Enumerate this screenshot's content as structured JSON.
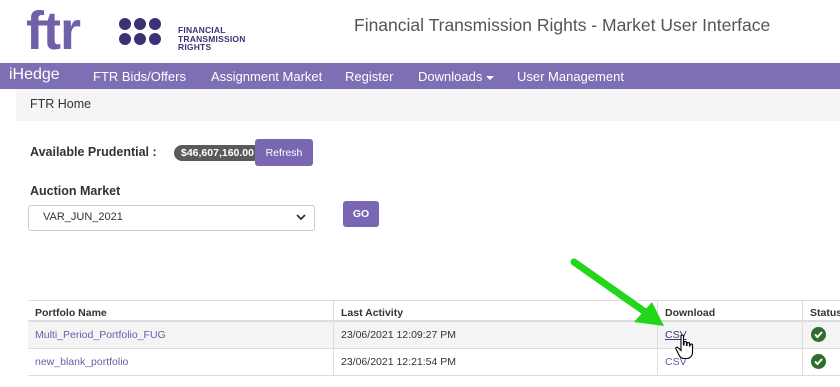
{
  "header": {
    "logo_letters": "ftr",
    "logo_lines": [
      "FINANCIAL",
      "TRANSMISSION",
      "RIGHTS"
    ],
    "app_title": "Financial Transmission Rights - Market User Interface"
  },
  "nav": {
    "brand": "iHedge",
    "items": [
      {
        "label": "FTR Bids/Offers"
      },
      {
        "label": "Assignment Market"
      },
      {
        "label": "Register"
      },
      {
        "label": "Downloads"
      },
      {
        "label": "User Management"
      }
    ]
  },
  "breadcrumb": "FTR Home",
  "prudential": {
    "label": "Available Prudential :",
    "amount": "$46,607,160.00",
    "refresh_label": "Refresh"
  },
  "auction": {
    "label": "Auction Market",
    "selected": "VAR_JUN_2021",
    "go_label": "GO"
  },
  "table": {
    "headers": [
      "Portfolo Name",
      "Last Activity",
      "Download",
      "Status"
    ],
    "rows": [
      {
        "name": "Multi_Period_Portfolio_FUG",
        "last_activity": "23/06/2021 12:09:27 PM",
        "download": "CSV",
        "status": "check-circle-icon"
      },
      {
        "name": "new_blank_portfolio",
        "last_activity": "23/06/2021 12:21:54 PM",
        "download": "CSV",
        "status": "check-circle-icon"
      }
    ]
  },
  "colors": {
    "brand_purple": "#7e6fb4",
    "button_purple": "#7a67b3",
    "arrow_green": "#22d61a",
    "status_green": "#2d6e2e"
  }
}
